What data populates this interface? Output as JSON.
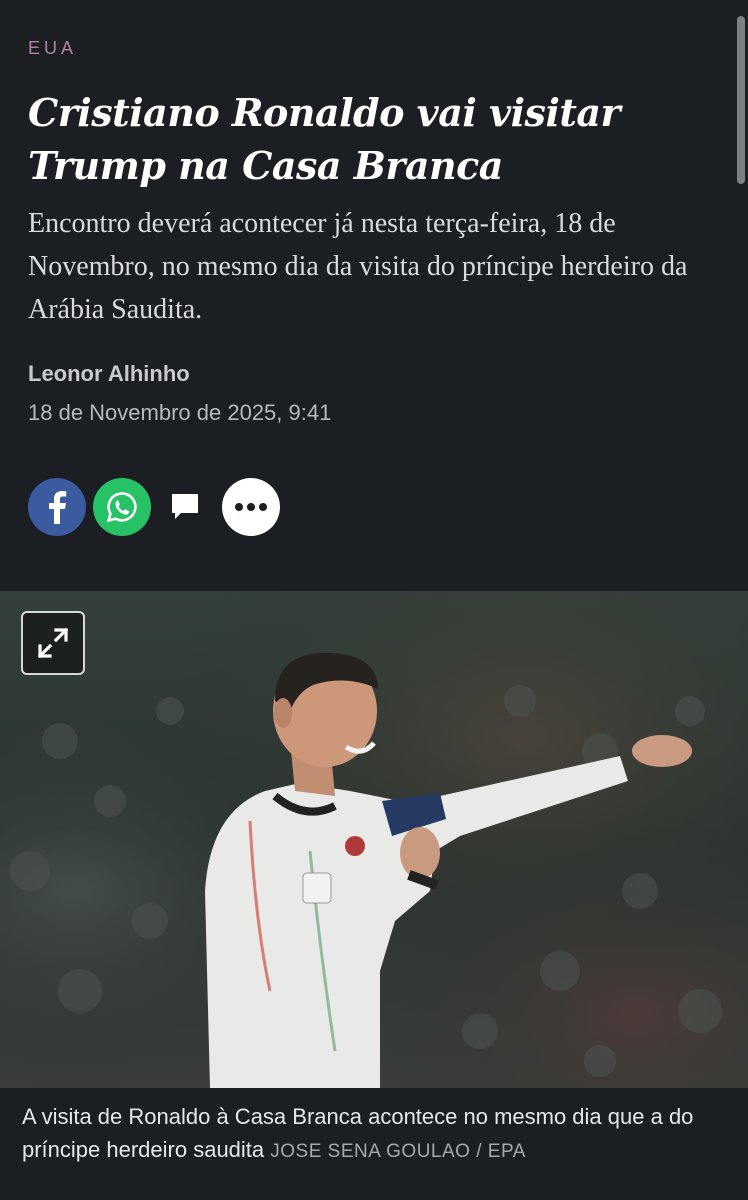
{
  "article": {
    "section": "EUA",
    "headline_line1": "Cristiano Ronaldo vai visitar",
    "headline_line2": "Trump na Casa Branca",
    "lead": "Encontro deverá acontecer já nesta terça-feira, 18 de Novembro, no mesmo dia da visita do príncipe herdeiro da Arábia Saudita.",
    "author": "Leonor Alhinho",
    "date": "18 de Novembro de 2025, 9:41"
  },
  "share": {
    "icons": [
      "facebook-icon",
      "whatsapp-icon",
      "comment-icon",
      "more-icon"
    ],
    "colors": {
      "facebook": "#3a5ba0",
      "whatsapp": "#27c266",
      "more": "#ffffff"
    }
  },
  "photo": {
    "expand_icon": "expand-icon"
  },
  "caption": {
    "text": "A visita de Ronaldo à Casa Branca acontece no mesmo dia que a do príncipe herdeiro saudita",
    "credit": "JOSE SENA GOULAO / EPA"
  },
  "colors": {
    "background": "#1b1e23",
    "section_label": "#b77fa6",
    "headline": "#ffffff"
  }
}
